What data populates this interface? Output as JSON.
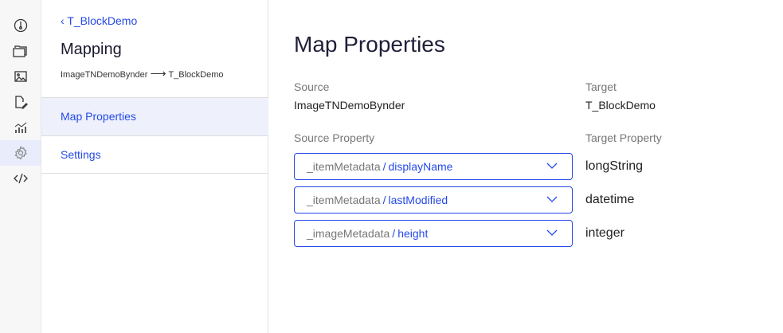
{
  "rail": {
    "icons": [
      "dashboard-icon",
      "folder-icon",
      "image-icon",
      "document-edit-icon",
      "analytics-icon",
      "settings-icon",
      "code-icon"
    ],
    "active": 5
  },
  "sidebar": {
    "back_label": "T_BlockDemo",
    "title": "Mapping",
    "source": "ImageTNDemoBynder",
    "target": "T_BlockDemo",
    "nav": [
      {
        "label": "Map Properties"
      },
      {
        "label": "Settings"
      }
    ]
  },
  "main": {
    "title": "Map Properties",
    "source_label": "Source",
    "source_value": "ImageTNDemoBynder",
    "target_label": "Target",
    "target_value": "T_BlockDemo",
    "source_property_label": "Source Property",
    "target_property_label": "Target Property",
    "mappings": [
      {
        "prefix": "_itemMetadata",
        "sep": "/",
        "field": "displayName",
        "target": "longString"
      },
      {
        "prefix": "_itemMetadata",
        "sep": "/",
        "field": "lastModified",
        "target": "datetime"
      },
      {
        "prefix": "_imageMetadata",
        "sep": "/",
        "field": "height",
        "target": "integer"
      }
    ]
  },
  "colors": {
    "accent": "#2549e8"
  }
}
